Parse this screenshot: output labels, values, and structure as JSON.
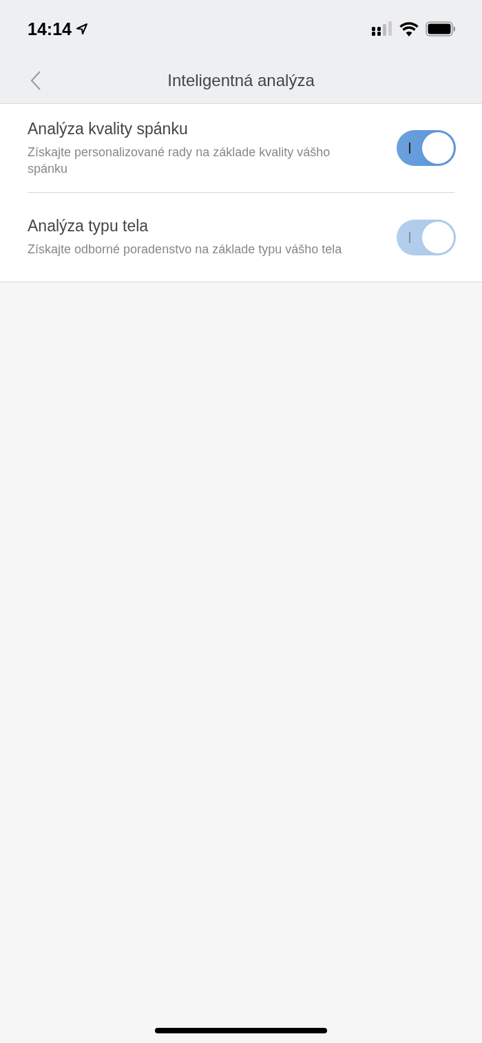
{
  "status_bar": {
    "time": "14:14"
  },
  "nav_bar": {
    "title": "Inteligentná analýza"
  },
  "settings": [
    {
      "title": "Analýza kvality spánku",
      "description": "Získajte personalizované rady na základe kvality vášho spánku",
      "on": true,
      "disabled": false
    },
    {
      "title": "Analýza typu tela",
      "description": "Získajte odborné poradenstvo na základe typu vášho tela",
      "on": true,
      "disabled": true
    }
  ]
}
